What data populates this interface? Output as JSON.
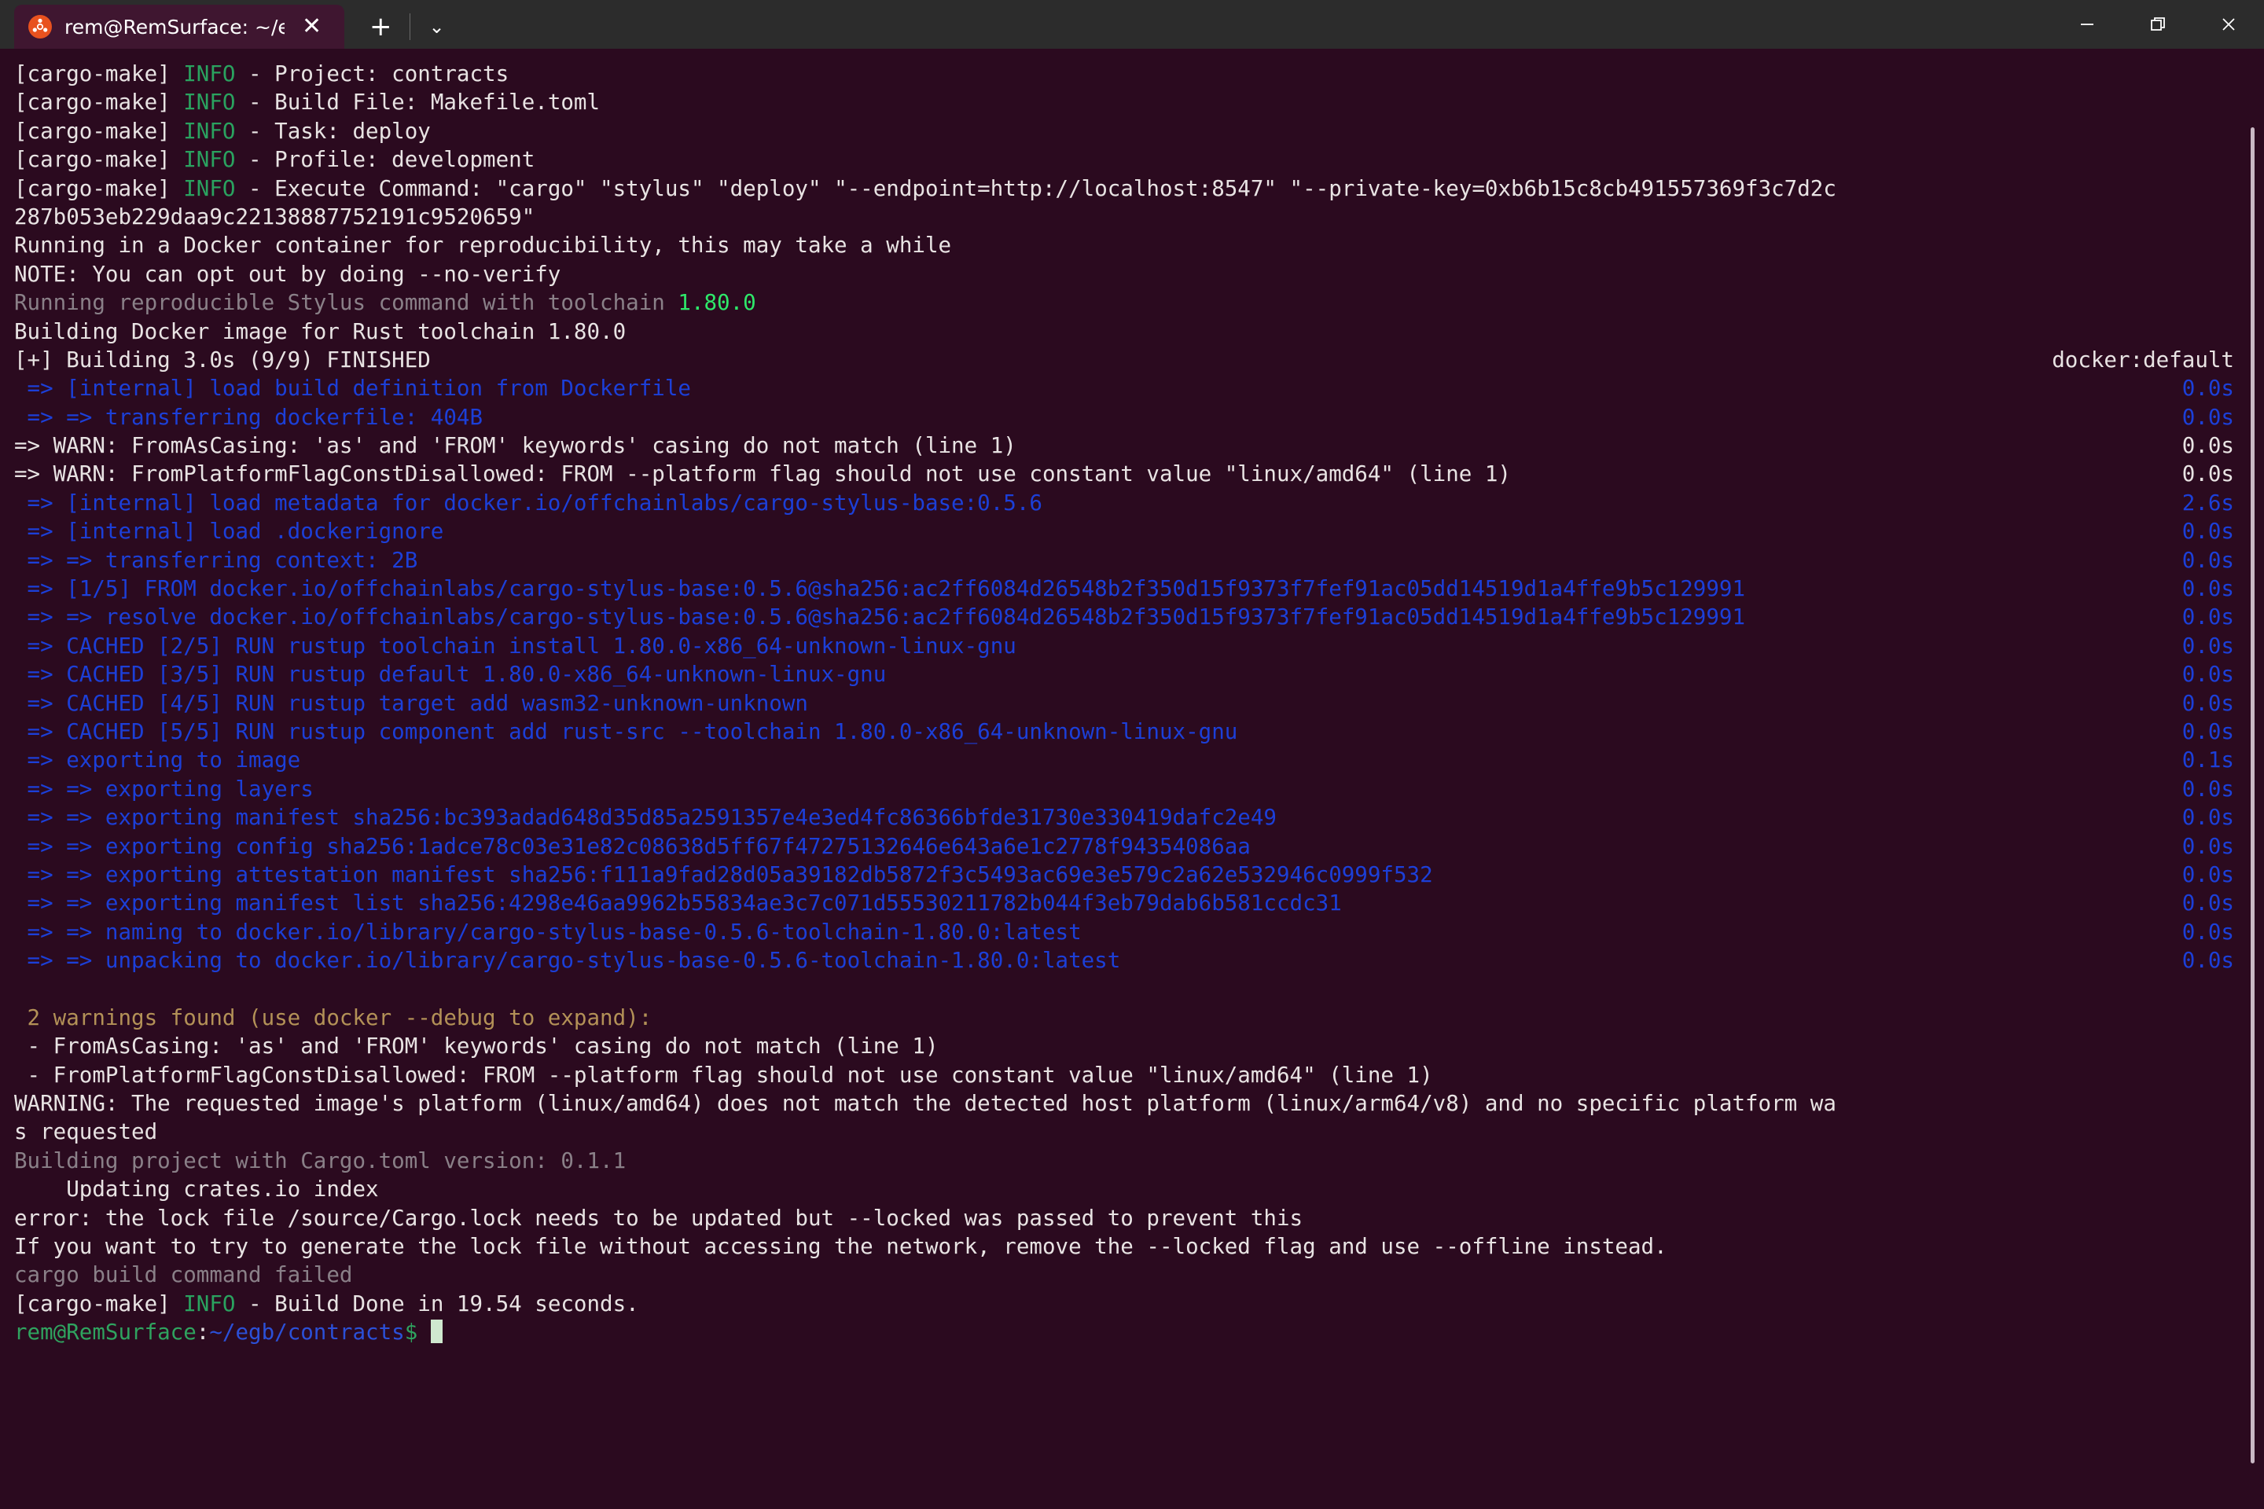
{
  "window": {
    "tab": {
      "icon": "ubuntu-logo-icon",
      "title": "rem@RemSurface: ~/egb/con",
      "close_label": "✕"
    },
    "new_tab_label": "+",
    "tab_list_label": "⌄",
    "controls": {
      "minimize": "minimize-icon",
      "restore": "restore-icon",
      "close": "close-icon"
    },
    "colors": {
      "titlebar_bg": "#2c2c2c",
      "tab_bg": "#3f1630",
      "terminal_bg": "#2b0a1f",
      "accent_orange": "#e8521f",
      "text_white": "#e8e3e3",
      "text_green": "#2aa25f",
      "text_bright_green": "#2ee86a",
      "text_blue": "#1c3fd8",
      "text_grey": "#8a8088",
      "text_tan": "#b39157",
      "cursor": "#cfe8cf",
      "scrollbar": "#c9b8c4"
    }
  },
  "terminal": {
    "lines": [
      {
        "segs": [
          {
            "t": "[cargo-make] ",
            "c": "white"
          },
          {
            "t": "INFO",
            "c": "green"
          },
          {
            "t": " - Project: contracts",
            "c": "white"
          }
        ]
      },
      {
        "segs": [
          {
            "t": "[cargo-make] ",
            "c": "white"
          },
          {
            "t": "INFO",
            "c": "green"
          },
          {
            "t": " - Build File: Makefile.toml",
            "c": "white"
          }
        ]
      },
      {
        "segs": [
          {
            "t": "[cargo-make] ",
            "c": "white"
          },
          {
            "t": "INFO",
            "c": "green"
          },
          {
            "t": " - Task: deploy",
            "c": "white"
          }
        ]
      },
      {
        "segs": [
          {
            "t": "[cargo-make] ",
            "c": "white"
          },
          {
            "t": "INFO",
            "c": "green"
          },
          {
            "t": " - Profile: development",
            "c": "white"
          }
        ]
      },
      {
        "segs": [
          {
            "t": "[cargo-make] ",
            "c": "white"
          },
          {
            "t": "INFO",
            "c": "green"
          },
          {
            "t": " - Execute Command: \"cargo\" \"stylus\" \"deploy\" \"--endpoint=http://localhost:8547\" \"--private-key=0xb6b15c8cb491557369f3c7d2c",
            "c": "white"
          }
        ]
      },
      {
        "segs": [
          {
            "t": "287b053eb229daa9c22138887752191c9520659\"",
            "c": "white"
          }
        ]
      },
      {
        "segs": [
          {
            "t": "Running in a Docker container for reproducibility, this may take a while",
            "c": "white"
          }
        ]
      },
      {
        "segs": [
          {
            "t": "NOTE: You can opt out by doing --no-verify",
            "c": "white"
          }
        ]
      },
      {
        "segs": [
          {
            "t": "Running reproducible Stylus command with toolchain ",
            "c": "grey"
          },
          {
            "t": "1.80.0",
            "c": "bgreen"
          }
        ]
      },
      {
        "segs": [
          {
            "t": "Building Docker image for Rust toolchain 1.80.0",
            "c": "white"
          }
        ]
      },
      {
        "segs": [
          {
            "t": "[+] Building 3.0s (9/9) FINISHED",
            "c": "white"
          }
        ],
        "dur": "docker:default",
        "dur_color": "white"
      },
      {
        "segs": [
          {
            "t": " => [internal] load build definition from Dockerfile",
            "c": "blue"
          }
        ],
        "dur": "0.0s",
        "dur_color": "blue"
      },
      {
        "segs": [
          {
            "t": " => => transferring dockerfile: 404B",
            "c": "blue"
          }
        ],
        "dur": "0.0s",
        "dur_color": "blue"
      },
      {
        "segs": [
          {
            "t": "=> WARN: FromAsCasing: 'as' and 'FROM' keywords' casing do not match (line 1)",
            "c": "white"
          }
        ],
        "dur": "0.0s",
        "dur_color": "white"
      },
      {
        "segs": [
          {
            "t": "=> WARN: FromPlatformFlagConstDisallowed: FROM --platform flag should not use constant value \"linux/amd64\" (line 1)",
            "c": "white"
          }
        ],
        "dur": "0.0s",
        "dur_color": "white"
      },
      {
        "segs": [
          {
            "t": " => [internal] load metadata for docker.io/offchainlabs/cargo-stylus-base:0.5.6",
            "c": "blue"
          }
        ],
        "dur": "2.6s",
        "dur_color": "blue"
      },
      {
        "segs": [
          {
            "t": " => [internal] load .dockerignore",
            "c": "blue"
          }
        ],
        "dur": "0.0s",
        "dur_color": "blue"
      },
      {
        "segs": [
          {
            "t": " => => transferring context: 2B",
            "c": "blue"
          }
        ],
        "dur": "0.0s",
        "dur_color": "blue"
      },
      {
        "segs": [
          {
            "t": " => [1/5] FROM docker.io/offchainlabs/cargo-stylus-base:0.5.6@sha256:ac2ff6084d26548b2f350d15f9373f7fef91ac05dd14519d1a4ffe9b5c129991",
            "c": "blue"
          }
        ],
        "dur": "0.0s",
        "dur_color": "blue"
      },
      {
        "segs": [
          {
            "t": " => => resolve docker.io/offchainlabs/cargo-stylus-base:0.5.6@sha256:ac2ff6084d26548b2f350d15f9373f7fef91ac05dd14519d1a4ffe9b5c129991",
            "c": "blue"
          }
        ],
        "dur": "0.0s",
        "dur_color": "blue"
      },
      {
        "segs": [
          {
            "t": " => CACHED [2/5] RUN rustup toolchain install 1.80.0-x86_64-unknown-linux-gnu",
            "c": "blue"
          }
        ],
        "dur": "0.0s",
        "dur_color": "blue"
      },
      {
        "segs": [
          {
            "t": " => CACHED [3/5] RUN rustup default 1.80.0-x86_64-unknown-linux-gnu",
            "c": "blue"
          }
        ],
        "dur": "0.0s",
        "dur_color": "blue"
      },
      {
        "segs": [
          {
            "t": " => CACHED [4/5] RUN rustup target add wasm32-unknown-unknown",
            "c": "blue"
          }
        ],
        "dur": "0.0s",
        "dur_color": "blue"
      },
      {
        "segs": [
          {
            "t": " => CACHED [5/5] RUN rustup component add rust-src --toolchain 1.80.0-x86_64-unknown-linux-gnu",
            "c": "blue"
          }
        ],
        "dur": "0.0s",
        "dur_color": "blue"
      },
      {
        "segs": [
          {
            "t": " => exporting to image",
            "c": "blue"
          }
        ],
        "dur": "0.1s",
        "dur_color": "blue"
      },
      {
        "segs": [
          {
            "t": " => => exporting layers",
            "c": "blue"
          }
        ],
        "dur": "0.0s",
        "dur_color": "blue"
      },
      {
        "segs": [
          {
            "t": " => => exporting manifest sha256:bc393adad648d35d85a2591357e4e3ed4fc86366bfde31730e330419dafc2e49",
            "c": "blue"
          }
        ],
        "dur": "0.0s",
        "dur_color": "blue"
      },
      {
        "segs": [
          {
            "t": " => => exporting config sha256:1adce78c03e31e82c08638d5ff67f47275132646e643a6e1c2778f94354086aa",
            "c": "blue"
          }
        ],
        "dur": "0.0s",
        "dur_color": "blue"
      },
      {
        "segs": [
          {
            "t": " => => exporting attestation manifest sha256:f111a9fad28d05a39182db5872f3c5493ac69e3e579c2a62e532946c0999f532",
            "c": "blue"
          }
        ],
        "dur": "0.0s",
        "dur_color": "blue"
      },
      {
        "segs": [
          {
            "t": " => => exporting manifest list sha256:4298e46aa9962b55834ae3c7c071d55530211782b044f3eb79dab6b581ccdc31",
            "c": "blue"
          }
        ],
        "dur": "0.0s",
        "dur_color": "blue"
      },
      {
        "segs": [
          {
            "t": " => => naming to docker.io/library/cargo-stylus-base-0.5.6-toolchain-1.80.0:latest",
            "c": "blue"
          }
        ],
        "dur": "0.0s",
        "dur_color": "blue"
      },
      {
        "segs": [
          {
            "t": " => => unpacking to docker.io/library/cargo-stylus-base-0.5.6-toolchain-1.80.0:latest",
            "c": "blue"
          }
        ],
        "dur": "0.0s",
        "dur_color": "blue"
      },
      {
        "segs": [
          {
            "t": "",
            "c": "white"
          }
        ]
      },
      {
        "segs": [
          {
            "t": " 2 warnings found (use docker --debug to expand):",
            "c": "tan"
          }
        ]
      },
      {
        "segs": [
          {
            "t": " - FromAsCasing: 'as' and 'FROM' keywords' casing do not match (line 1)",
            "c": "white"
          }
        ]
      },
      {
        "segs": [
          {
            "t": " - FromPlatformFlagConstDisallowed: FROM --platform flag should not use constant value \"linux/amd64\" (line 1)",
            "c": "white"
          }
        ]
      },
      {
        "segs": [
          {
            "t": "WARNING: The requested image's platform (linux/amd64) does not match the detected host platform (linux/arm64/v8) and no specific platform wa",
            "c": "white"
          }
        ]
      },
      {
        "segs": [
          {
            "t": "s requested",
            "c": "white"
          }
        ]
      },
      {
        "segs": [
          {
            "t": "Building project with Cargo.toml version: 0.1.1",
            "c": "grey"
          }
        ]
      },
      {
        "segs": [
          {
            "t": "    Updating crates.io index",
            "c": "white"
          }
        ]
      },
      {
        "segs": [
          {
            "t": "error: the lock file /source/Cargo.lock needs to be updated but --locked was passed to prevent this",
            "c": "white"
          }
        ]
      },
      {
        "segs": [
          {
            "t": "If you want to try to generate the lock file without accessing the network, remove the --locked flag and use --offline instead.",
            "c": "white"
          }
        ]
      },
      {
        "segs": [
          {
            "t": "cargo build command failed",
            "c": "grey"
          }
        ]
      },
      {
        "segs": [
          {
            "t": "[cargo-make] ",
            "c": "white"
          },
          {
            "t": "INFO",
            "c": "green"
          },
          {
            "t": " - Build Done in 19.54 seconds.",
            "c": "white"
          }
        ]
      }
    ],
    "prompt": {
      "user_host": "rem@RemSurface",
      "colon": ":",
      "path": "~/egb/contracts",
      "sigil": "$"
    }
  }
}
